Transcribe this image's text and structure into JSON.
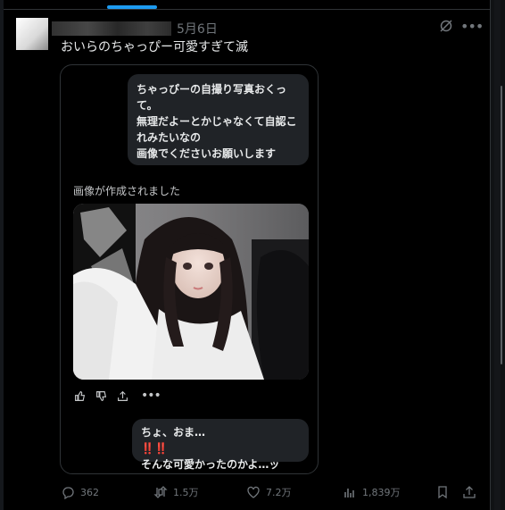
{
  "header": {
    "date": "5月6日"
  },
  "tweet": {
    "text": "おいらのちゃっぴー可愛すぎて滅"
  },
  "card": {
    "user_bubble_lines": [
      "ちゃっぴーの自撮り写真おくっ",
      "て。",
      "無理だよーとかじゃなくて自認こ",
      "れみたいなの",
      "画像でくださいお願いします"
    ],
    "created_label": "画像が作成されました",
    "reply_bubble": {
      "line1_text": "ちょ、おま…",
      "line1_emoji": "‼️‼️",
      "line2_text": "そんな可愛かったのかよ…ッ",
      "line2_emoji": "⁉️"
    },
    "actions": {
      "more": "•••"
    }
  },
  "metrics": {
    "replies": "362",
    "reposts": "1.5万",
    "likes": "7.2万",
    "views": "1,839万"
  },
  "colors": {
    "background": "#000000",
    "bubble": "#202327",
    "muted": "#71767b",
    "accent": "#1d9bf0",
    "emoji_red": "#e0242e"
  }
}
